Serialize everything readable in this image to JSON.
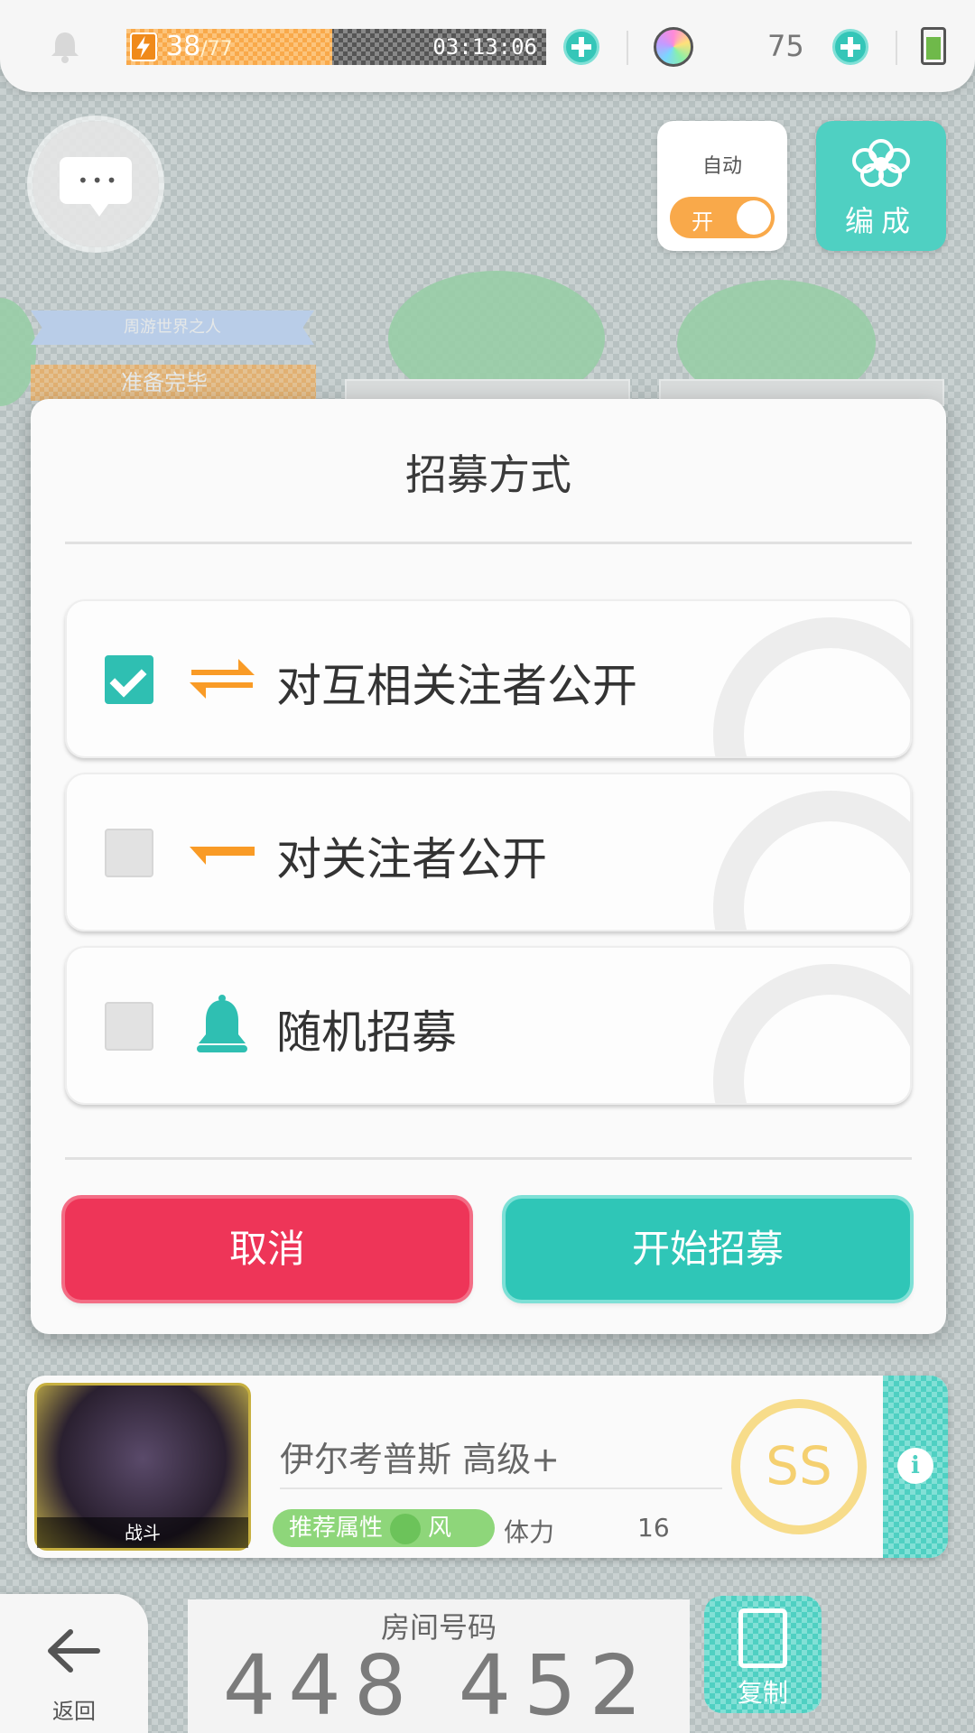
{
  "topbar": {
    "stamina_current": "38",
    "stamina_max": "/77",
    "stamina_fraction": 0.49,
    "timer": "03:13:06",
    "gem_count": "75",
    "icons": [
      "bell-icon",
      "lightning-icon",
      "plus-icon",
      "gem-icon",
      "battery-icon"
    ]
  },
  "controls": {
    "auto_label": "自动",
    "auto_toggle_state": "开",
    "formation_label": "编成"
  },
  "party": {
    "ribbon_text": "周游世界之人",
    "ready_text": "准备完毕"
  },
  "modal": {
    "title": "招募方式",
    "options": [
      {
        "label": "对互相关注者公开",
        "checked": true,
        "icon": "mutual-arrows-icon"
      },
      {
        "label": "对关注者公开",
        "checked": false,
        "icon": "follow-arrow-icon"
      },
      {
        "label": "随机招募",
        "checked": false,
        "icon": "bell-icon"
      }
    ],
    "cancel_label": "取消",
    "start_label": "开始招募"
  },
  "boss": {
    "portrait_label": "战斗",
    "name": "伊尔考普斯 高级+",
    "attribute_prefix": "推荐属性",
    "attribute": "风",
    "stamina_label": "体力",
    "stamina_value": "16",
    "rank": "SS"
  },
  "bottom": {
    "back_label": "返回",
    "room_label": "房间号码",
    "room_number": "448 452",
    "copy_label": "复制"
  },
  "colors": {
    "teal": "#2fc6b7",
    "red": "#ee3558",
    "orange": "#f9a94a"
  }
}
